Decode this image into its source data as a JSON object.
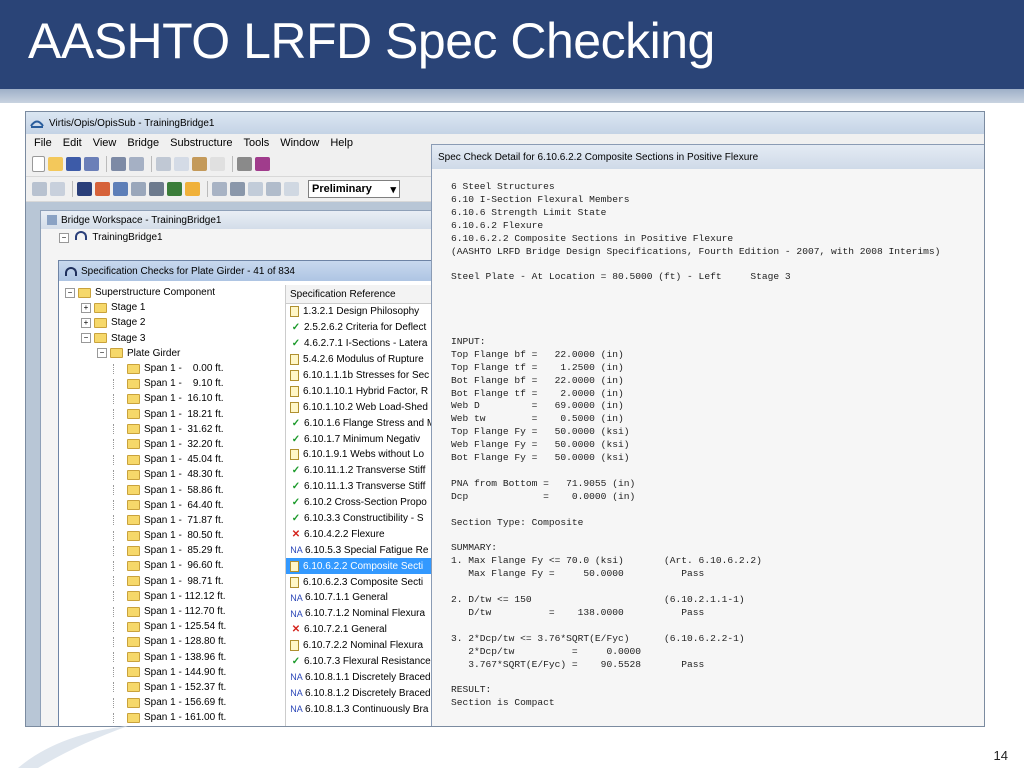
{
  "slide": {
    "title": "AASHTO LRFD Spec Checking",
    "page_number": "14"
  },
  "app": {
    "window_title": "Virtis/Opis/OpisSub - TrainingBridge1",
    "menu": [
      "File",
      "Edit",
      "View",
      "Bridge",
      "Substructure",
      "Tools",
      "Window",
      "Help"
    ],
    "mode_dropdown": "Preliminary"
  },
  "workspace": {
    "title": "Bridge Workspace - TrainingBridge1",
    "root": "TrainingBridge1"
  },
  "spec_window": {
    "title": "Specification Checks for Plate Girder - 41 of 834",
    "tree": [
      {
        "label": "Superstructure Component",
        "level": 0,
        "expander": "⊟"
      },
      {
        "label": "Stage 1",
        "level": 1,
        "expander": "⊞"
      },
      {
        "label": "Stage 2",
        "level": 1,
        "expander": "⊞"
      },
      {
        "label": "Stage 3",
        "level": 1,
        "expander": "⊟"
      },
      {
        "label": "Plate Girder",
        "level": 2,
        "expander": "⊟"
      },
      {
        "label": "Span 1 -    0.00 ft.",
        "level": 3,
        "expander": ""
      },
      {
        "label": "Span 1 -    9.10 ft.",
        "level": 3,
        "expander": ""
      },
      {
        "label": "Span 1 -  16.10 ft.",
        "level": 3,
        "expander": ""
      },
      {
        "label": "Span 1 -  18.21 ft.",
        "level": 3,
        "expander": ""
      },
      {
        "label": "Span 1 -  31.62 ft.",
        "level": 3,
        "expander": ""
      },
      {
        "label": "Span 1 -  32.20 ft.",
        "level": 3,
        "expander": ""
      },
      {
        "label": "Span 1 -  45.04 ft.",
        "level": 3,
        "expander": ""
      },
      {
        "label": "Span 1 -  48.30 ft.",
        "level": 3,
        "expander": ""
      },
      {
        "label": "Span 1 -  58.86 ft.",
        "level": 3,
        "expander": ""
      },
      {
        "label": "Span 1 -  64.40 ft.",
        "level": 3,
        "expander": ""
      },
      {
        "label": "Span 1 -  71.87 ft.",
        "level": 3,
        "expander": ""
      },
      {
        "label": "Span 1 -  80.50 ft.",
        "level": 3,
        "expander": ""
      },
      {
        "label": "Span 1 -  85.29 ft.",
        "level": 3,
        "expander": ""
      },
      {
        "label": "Span 1 -  96.60 ft.",
        "level": 3,
        "expander": ""
      },
      {
        "label": "Span 1 -  98.71 ft.",
        "level": 3,
        "expander": ""
      },
      {
        "label": "Span 1 - 112.12 ft.",
        "level": 3,
        "expander": ""
      },
      {
        "label": "Span 1 - 112.70 ft.",
        "level": 3,
        "expander": ""
      },
      {
        "label": "Span 1 - 125.54 ft.",
        "level": 3,
        "expander": ""
      },
      {
        "label": "Span 1 - 128.80 ft.",
        "level": 3,
        "expander": ""
      },
      {
        "label": "Span 1 - 138.96 ft.",
        "level": 3,
        "expander": ""
      },
      {
        "label": "Span 1 - 144.90 ft.",
        "level": 3,
        "expander": ""
      },
      {
        "label": "Span 1 - 152.37 ft.",
        "level": 3,
        "expander": ""
      },
      {
        "label": "Span 1 - 156.69 ft.",
        "level": 3,
        "expander": ""
      },
      {
        "label": "Span 1 - 161.00 ft.",
        "level": 3,
        "expander": ""
      }
    ],
    "reference_header": "Specification Reference",
    "references": [
      {
        "status": "doc",
        "label": "1.3.2.1 Design Philosophy"
      },
      {
        "status": "pass",
        "label": "2.5.2.6.2 Criteria for Deflect"
      },
      {
        "status": "pass",
        "label": "4.6.2.7.1 I-Sections - Latera"
      },
      {
        "status": "doc",
        "label": "5.4.2.6 Modulus of Rupture"
      },
      {
        "status": "doc",
        "label": "6.10.1.1.1b Stresses for Sec"
      },
      {
        "status": "doc",
        "label": "6.10.1.10.1 Hybrid Factor, R"
      },
      {
        "status": "doc",
        "label": "6.10.1.10.2 Web Load-Shed"
      },
      {
        "status": "pass",
        "label": "6.10.1.6 Flange Stress and M"
      },
      {
        "status": "pass",
        "label": "6.10.1.7 Minimum Negativ"
      },
      {
        "status": "doc",
        "label": "6.10.1.9.1 Webs without Lo"
      },
      {
        "status": "pass",
        "label": "6.10.11.1.2 Transverse Stiff"
      },
      {
        "status": "pass",
        "label": "6.10.11.1.3 Transverse Stiff"
      },
      {
        "status": "pass",
        "label": "6.10.2 Cross-Section Propo"
      },
      {
        "status": "pass",
        "label": "6.10.3.3 Constructibility - S"
      },
      {
        "status": "fail",
        "label": "6.10.4.2.2 Flexure"
      },
      {
        "status": "na",
        "label": "6.10.5.3 Special Fatigue Re"
      },
      {
        "status": "doc",
        "label": "6.10.6.2.2 Composite Secti",
        "selected": true
      },
      {
        "status": "doc",
        "label": "6.10.6.2.3 Composite Secti"
      },
      {
        "status": "na",
        "label": "6.10.7.1.1 General"
      },
      {
        "status": "na",
        "label": "6.10.7.1.2 Nominal Flexura"
      },
      {
        "status": "fail",
        "label": "6.10.7.2.1 General"
      },
      {
        "status": "doc",
        "label": "6.10.7.2.2 Nominal Flexura"
      },
      {
        "status": "pass",
        "label": "6.10.7.3 Flexural Resistance"
      },
      {
        "status": "na",
        "label": "6.10.8.1.1 Discretely Braced"
      },
      {
        "status": "na",
        "label": "6.10.8.1.2 Discretely Braced"
      },
      {
        "status": "na",
        "label": "6.10.8.1.3 Continuously Bra"
      }
    ]
  },
  "detail": {
    "title": "Spec Check Detail for 6.10.6.2.2 Composite Sections in Positive Flexure",
    "text": "6 Steel Structures\n6.10 I-Section Flexural Members\n6.10.6 Strength Limit State\n6.10.6.2 Flexure\n6.10.6.2.2 Composite Sections in Positive Flexure\n(AASHTO LRFD Bridge Design Specifications, Fourth Edition - 2007, with 2008 Interims)\n\nSteel Plate - At Location = 80.5000 (ft) - Left     Stage 3\n\n\n\n\nINPUT:\nTop Flange bf =   22.0000 (in)\nTop Flange tf =    1.2500 (in)\nBot Flange bf =   22.0000 (in)\nBot Flange tf =    2.0000 (in)\nWeb D         =   69.0000 (in)\nWeb tw        =    0.5000 (in)\nTop Flange Fy =   50.0000 (ksi)\nWeb Flange Fy =   50.0000 (ksi)\nBot Flange Fy =   50.0000 (ksi)\n\nPNA from Bottom =   71.9055 (in)\nDcp             =    0.0000 (in)\n\nSection Type: Composite\n\nSUMMARY:\n1. Max Flange Fy <= 70.0 (ksi)       (Art. 6.10.6.2.2)\n   Max Flange Fy =     50.0000          Pass\n\n2. D/tw <= 150                       (6.10.2.1.1-1)\n   D/tw          =    138.0000          Pass\n\n3. 2*Dcp/tw <= 3.76*SQRT(E/Fyc)      (6.10.6.2.2-1)\n   2*Dcp/tw          =     0.0000\n   3.767*SQRT(E/Fyc) =    90.5528       Pass\n\nRESULT:\nSection is Compact"
  },
  "colors": {
    "header_bg": "#2a4477",
    "pass": "#1c9a2b",
    "fail": "#d4231c",
    "na": "#2b47b8",
    "selection": "#3399ff"
  }
}
